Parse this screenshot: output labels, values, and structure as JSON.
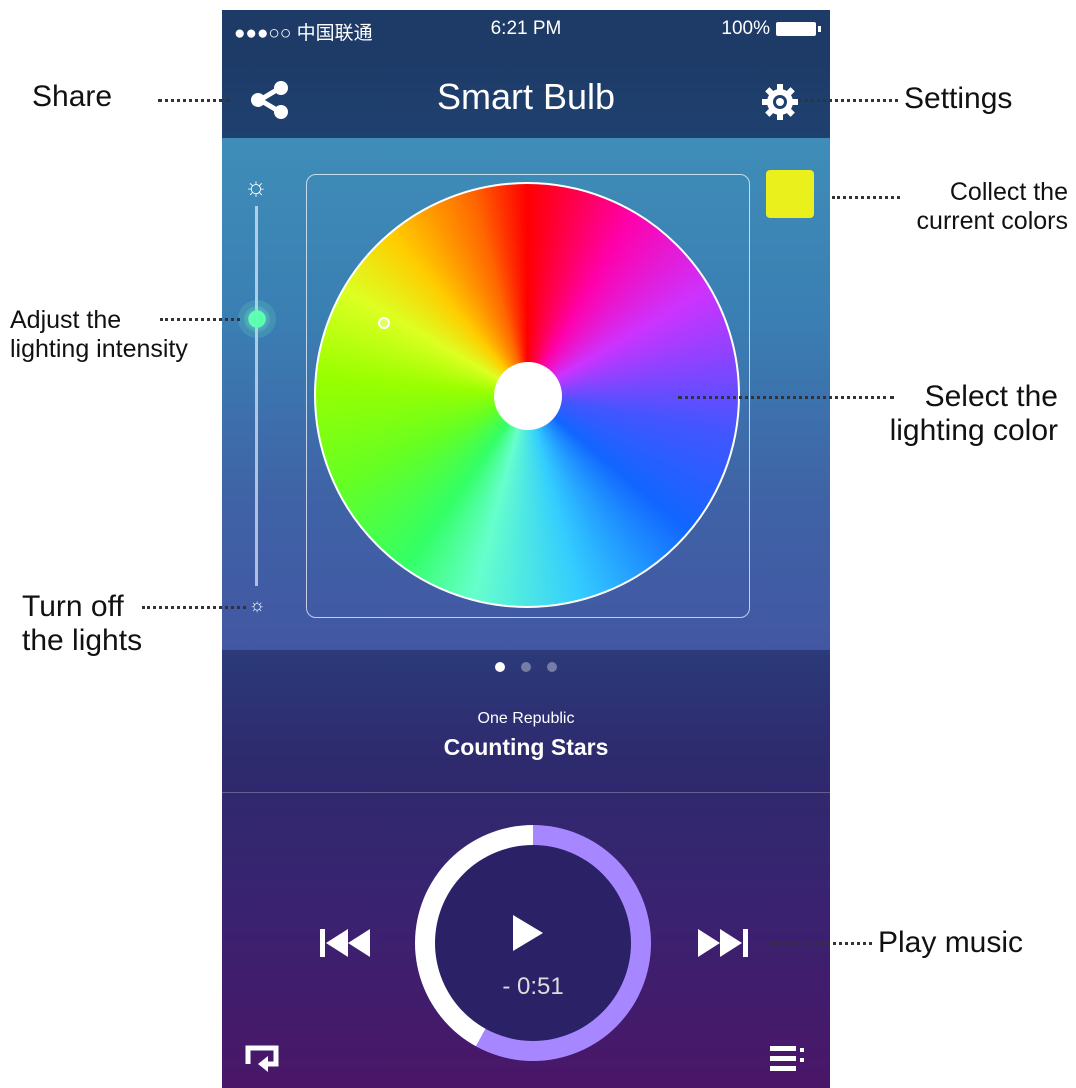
{
  "status_bar": {
    "signal": "●●●○○ 中国联通 ",
    "time": "6:21 PM",
    "battery": "100%"
  },
  "nav": {
    "title": "Smart Bulb"
  },
  "icons": {
    "share": "share-icon",
    "settings": "gear-icon",
    "brightness_high": "sun-icon",
    "brightness_low": "sun-small-icon",
    "prev": "skip-back-icon",
    "play": "play-icon",
    "next": "skip-forward-icon",
    "repeat": "repeat-icon",
    "playlist": "playlist-icon"
  },
  "color_picker": {
    "collected_color": "#e9f01c"
  },
  "brightness": {
    "level": 0.7
  },
  "pager": {
    "pages": 3,
    "current": 1
  },
  "now_playing": {
    "artist": "One Republic",
    "song": "Counting Stars",
    "remaining": "- 0:51",
    "progress": 0.58
  },
  "annotations": {
    "share": "Share",
    "settings": "Settings",
    "collect": "Collect the\ncurrent colors",
    "adjust": "Adjust the\nlighting intensity",
    "select": "Select the\nlighting color",
    "turn_off": "Turn off\nthe lights",
    "play": "Play music"
  }
}
